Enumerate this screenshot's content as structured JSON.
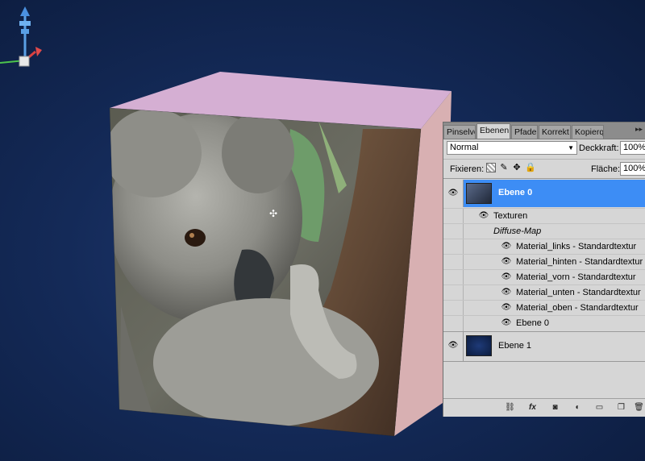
{
  "scene": {
    "background_color": "#142a58"
  },
  "panel": {
    "tabs": [
      {
        "label": "Pinselvo",
        "active": false
      },
      {
        "label": "Ebenen",
        "active": true
      },
      {
        "label": "Pfade",
        "active": false
      },
      {
        "label": "Korrekt",
        "active": false
      },
      {
        "label": "Kopierq",
        "active": false
      }
    ],
    "menu_glyph": "▸▸",
    "blend_mode": "Normal",
    "opacity_label": "Deckkraft:",
    "opacity_value": "100%",
    "lock_label": "Fixieren:",
    "fill_label": "Fläche:",
    "fill_value": "100%",
    "layers": {
      "main": {
        "name": "Ebene 0",
        "selected": true
      },
      "textures_label": "Texturen",
      "diffuse_label": "Diffuse-Map",
      "textures": [
        "Material_links - Standardtextur",
        "Material_hinten - Standardtextur",
        "Material_vorn - Standardtextur",
        "Material_unten - Standardtextur",
        "Material_oben - Standardtextur",
        "Ebene 0"
      ],
      "second": {
        "name": "Ebene 1"
      }
    },
    "bottom_icons": [
      "link-icon",
      "fx-icon",
      "mask-icon",
      "adjustment-icon",
      "folder-icon",
      "new-layer-icon",
      "trash-icon"
    ],
    "bottom_fx_label": "fx",
    "accent_color": "#3d8df5"
  }
}
